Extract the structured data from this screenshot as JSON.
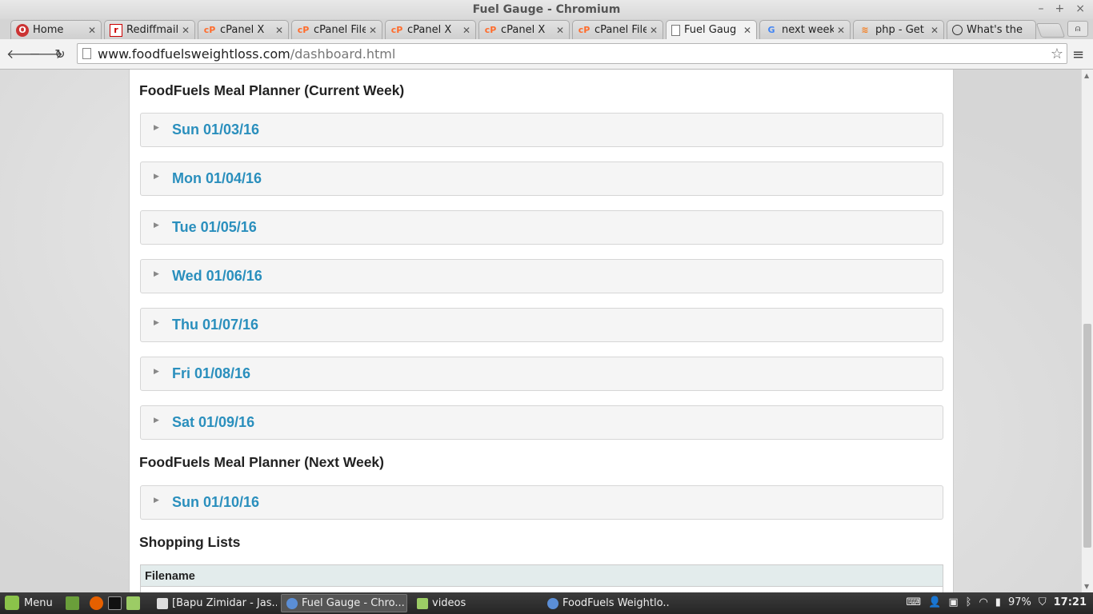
{
  "window": {
    "title": "Fuel Gauge - Chromium"
  },
  "tabs": [
    {
      "label": "Home",
      "icon": "opera-icon"
    },
    {
      "label": "Rediffmail",
      "icon": "rediff-icon"
    },
    {
      "label": "cPanel X",
      "icon": "cpanel-icon"
    },
    {
      "label": "cPanel File",
      "icon": "cpanel-icon"
    },
    {
      "label": "cPanel X",
      "icon": "cpanel-icon"
    },
    {
      "label": "cPanel X",
      "icon": "cpanel-icon"
    },
    {
      "label": "cPanel File",
      "icon": "cpanel-icon"
    },
    {
      "label": "Fuel Gaug",
      "icon": "page-icon"
    },
    {
      "label": "next week",
      "icon": "google-icon"
    },
    {
      "label": "php - Get",
      "icon": "stackoverflow-icon"
    },
    {
      "label": "What's the",
      "icon": "clock-icon"
    }
  ],
  "toolbar": {
    "url_host": "www.foodfuelsweightloss.com",
    "url_path": "/dashboard.html"
  },
  "page": {
    "current_week_title": "FoodFuels Meal Planner (Current Week)",
    "current_week_days": [
      "Sun 01/03/16",
      "Mon 01/04/16",
      "Tue 01/05/16",
      "Wed 01/06/16",
      "Thu 01/07/16",
      "Fri 01/08/16",
      "Sat 01/09/16"
    ],
    "next_week_title": "FoodFuels Meal Planner (Next Week)",
    "next_week_days": [
      "Sun 01/10/16"
    ],
    "shopping_title": "Shopping Lists",
    "shopping_table_header": "Filename"
  },
  "taskbar": {
    "menu_label": "Menu",
    "tasks": [
      "[Bapu Zimidar - Jas...",
      "Fuel Gauge - Chro...",
      "videos",
      "FoodFuels Weightlo..."
    ],
    "battery": "97%",
    "clock": "17:21"
  },
  "colors": {
    "accent_link": "#2a8fbd",
    "taskbar": "#2e2e2e"
  }
}
